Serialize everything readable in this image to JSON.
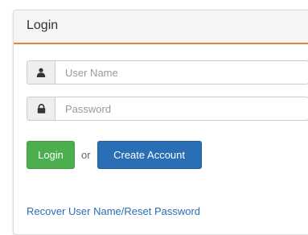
{
  "panel": {
    "title": "Login"
  },
  "username": {
    "placeholder": "User Name",
    "icon": "user-icon"
  },
  "password": {
    "placeholder": "Password",
    "icon": "lock-icon"
  },
  "actions": {
    "login_label": "Login",
    "or_text": "or",
    "create_label": "Create Account"
  },
  "links": {
    "recover_label": "Recover User Name/Reset Password"
  },
  "colors": {
    "accent_border": "#e8833a",
    "login_button": "#4cae4c",
    "create_button": "#2a6fb5",
    "link": "#2a6fb5"
  }
}
